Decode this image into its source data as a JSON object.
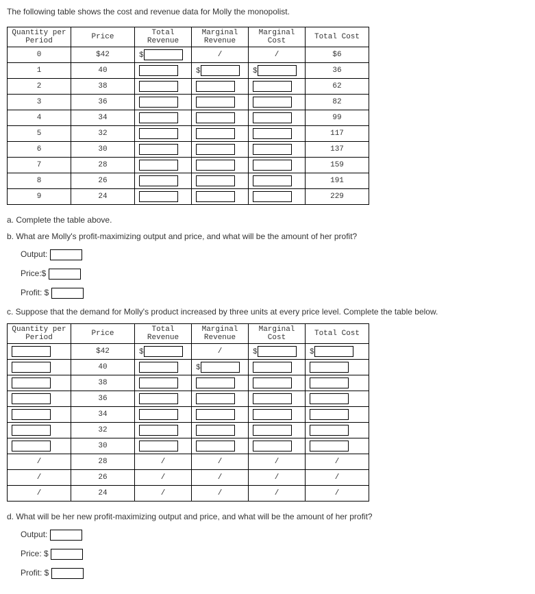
{
  "intro": "The following table shows the cost and revenue data for Molly the monopolist.",
  "headers": {
    "qty": "Quantity per Period",
    "price": "Price",
    "tr": "Total Revenue",
    "mr": "Marginal Revenue",
    "mc": "Marginal Cost",
    "tc": "Total Cost"
  },
  "table1": {
    "rows": [
      {
        "qty": "0",
        "price": "$42",
        "tr_prefix": "$",
        "tr_input": true,
        "mr": "/",
        "mc": "/",
        "tc": "$6"
      },
      {
        "qty": "1",
        "price": "40",
        "tr_input": true,
        "mr_prefix": "$",
        "mr_input": true,
        "mc_prefix": "$",
        "mc_input": true,
        "tc": "36"
      },
      {
        "qty": "2",
        "price": "38",
        "tr_input": true,
        "mr_input": true,
        "mc_input": true,
        "tc": "62"
      },
      {
        "qty": "3",
        "price": "36",
        "tr_input": true,
        "mr_input": true,
        "mc_input": true,
        "tc": "82"
      },
      {
        "qty": "4",
        "price": "34",
        "tr_input": true,
        "mr_input": true,
        "mc_input": true,
        "tc": "99"
      },
      {
        "qty": "5",
        "price": "32",
        "tr_input": true,
        "mr_input": true,
        "mc_input": true,
        "tc": "117"
      },
      {
        "qty": "6",
        "price": "30",
        "tr_input": true,
        "mr_input": true,
        "mc_input": true,
        "tc": "137"
      },
      {
        "qty": "7",
        "price": "28",
        "tr_input": true,
        "mr_input": true,
        "mc_input": true,
        "tc": "159"
      },
      {
        "qty": "8",
        "price": "26",
        "tr_input": true,
        "mr_input": true,
        "mc_input": true,
        "tc": "191"
      },
      {
        "qty": "9",
        "price": "24",
        "tr_input": true,
        "mr_input": true,
        "mc_input": true,
        "tc": "229"
      }
    ]
  },
  "qa": "a. Complete the table above.",
  "qb": "b. What are Molly's profit-maximizing output and price, and what will be the amount of her profit?",
  "labels": {
    "output": "Output:",
    "price": "Price:$",
    "price2": "Price: $",
    "profit": "Profit: $"
  },
  "qc": "c. Suppose that the demand for Molly's product increased by three units at every price level. Complete the table below.",
  "table2": {
    "rows": [
      {
        "qty_input": true,
        "price": "$42",
        "tr_prefix": "$",
        "tr_input": true,
        "mr": "/",
        "mc_prefix": "$",
        "mc_input": true,
        "tc_prefix": "$",
        "tc_input": true
      },
      {
        "qty_input": true,
        "price": "40",
        "tr_input": true,
        "mr_prefix": "$",
        "mr_input": true,
        "mc_input": true,
        "tc_input": true
      },
      {
        "qty_input": true,
        "price": "38",
        "tr_input": true,
        "mr_input": true,
        "mc_input": true,
        "tc_input": true
      },
      {
        "qty_input": true,
        "price": "36",
        "tr_input": true,
        "mr_input": true,
        "mc_input": true,
        "tc_input": true
      },
      {
        "qty_input": true,
        "price": "34",
        "tr_input": true,
        "mr_input": true,
        "mc_input": true,
        "tc_input": true
      },
      {
        "qty_input": true,
        "price": "32",
        "tr_input": true,
        "mr_input": true,
        "mc_input": true,
        "tc_input": true
      },
      {
        "qty_input": true,
        "price": "30",
        "tr_input": true,
        "mr_input": true,
        "mc_input": true,
        "tc_input": true
      },
      {
        "qty": "/",
        "price": "28",
        "tr": "/",
        "mr": "/",
        "mc": "/",
        "tc": "/"
      },
      {
        "qty": "/",
        "price": "26",
        "tr": "/",
        "mr": "/",
        "mc": "/",
        "tc": "/"
      },
      {
        "qty": "/",
        "price": "24",
        "tr": "/",
        "mr": "/",
        "mc": "/",
        "tc": "/"
      }
    ]
  },
  "qd": "d. What will be her new profit-maximizing output and price, and what will be the amount of her profit?"
}
